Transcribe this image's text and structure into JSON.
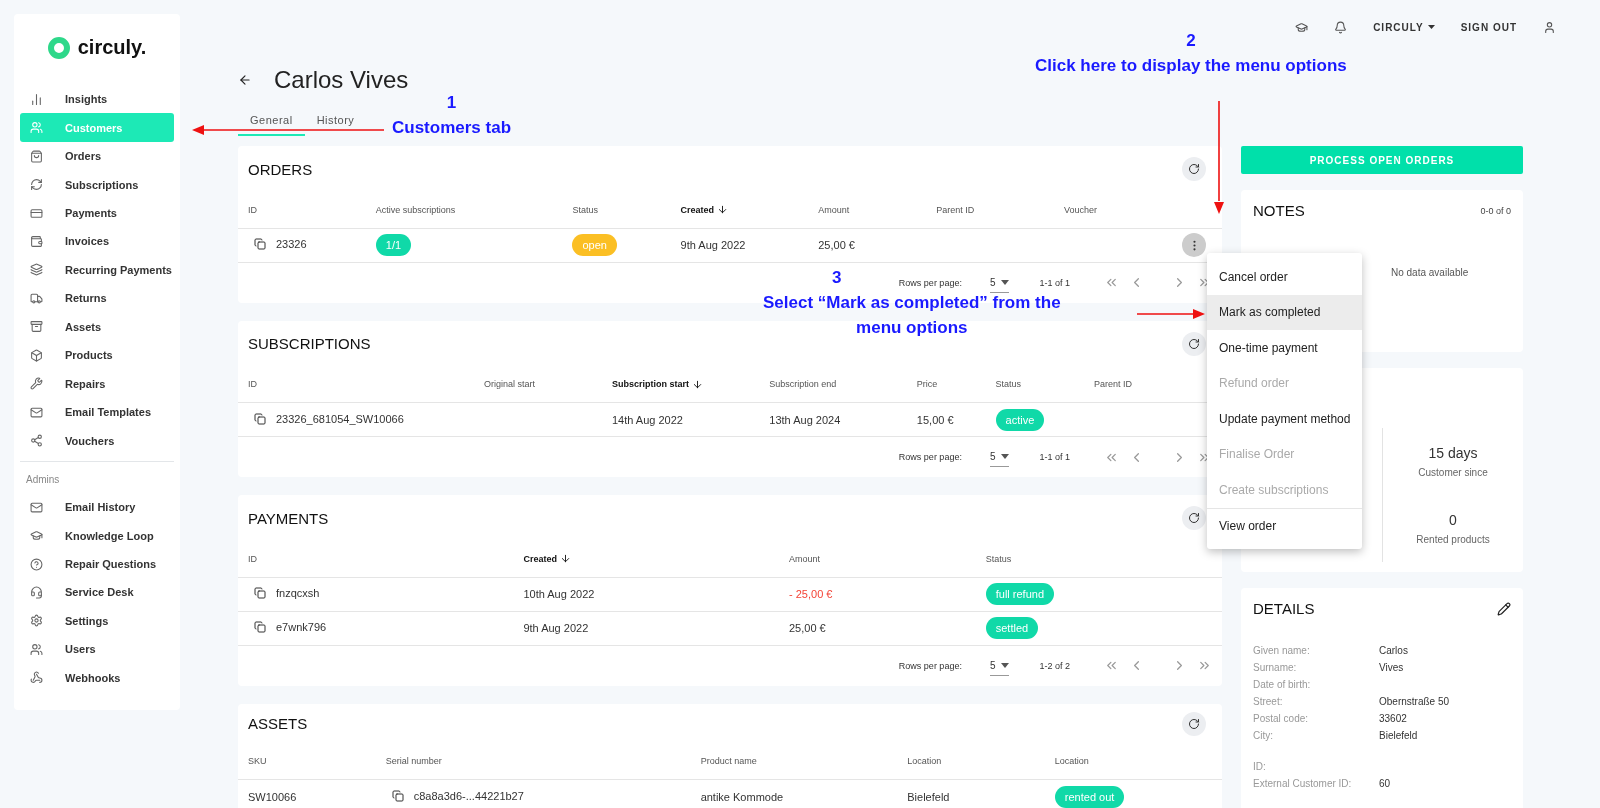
{
  "topbar": {
    "account": "CIRCULY",
    "sign_out": "SIGN OUT"
  },
  "sidebar": {
    "logo": "circuly.",
    "items": [
      {
        "label": "Insights",
        "selected": false
      },
      {
        "label": "Customers",
        "selected": true
      },
      {
        "label": "Orders",
        "selected": false
      },
      {
        "label": "Subscriptions",
        "selected": false
      },
      {
        "label": "Payments",
        "selected": false
      },
      {
        "label": "Invoices",
        "selected": false
      },
      {
        "label": "Recurring Payments",
        "selected": false
      },
      {
        "label": "Returns",
        "selected": false
      },
      {
        "label": "Assets",
        "selected": false
      },
      {
        "label": "Products",
        "selected": false
      },
      {
        "label": "Repairs",
        "selected": false
      },
      {
        "label": "Email Templates",
        "selected": false
      },
      {
        "label": "Vouchers",
        "selected": false
      }
    ],
    "section": "Admins",
    "admin_items": [
      {
        "label": "Email History",
        "selected": false
      },
      {
        "label": "Knowledge Loop",
        "selected": false
      },
      {
        "label": "Repair Questions",
        "selected": false
      },
      {
        "label": "Service Desk",
        "selected": false
      },
      {
        "label": "Settings",
        "selected": false
      },
      {
        "label": "Users",
        "selected": false
      },
      {
        "label": "Webhooks",
        "selected": false
      }
    ]
  },
  "page": {
    "title": "Carlos Vives",
    "tabs": [
      {
        "label": "General",
        "selected": true
      },
      {
        "label": "History",
        "selected": false
      }
    ]
  },
  "orders": {
    "title": "ORDERS",
    "columns": [
      {
        "label": "ID",
        "sorted": false
      },
      {
        "label": "Active subscriptions",
        "sorted": false
      },
      {
        "label": "Status",
        "sorted": false
      },
      {
        "label": "Created",
        "sorted": true
      },
      {
        "label": "Amount",
        "sorted": false
      },
      {
        "label": "Parent ID",
        "sorted": false
      },
      {
        "label": "Voucher",
        "sorted": false
      }
    ],
    "rows": [
      {
        "id": "23326",
        "active": "1/1",
        "status": "open",
        "color": "#fbbf24",
        "created": "9th Aug 2022",
        "amount": "25,00 €"
      }
    ],
    "pagination": {
      "label": "Rows per page:",
      "size": "5",
      "range": "1-1 of 1"
    }
  },
  "subscriptions": {
    "title": "SUBSCRIPTIONS",
    "columns": [
      {
        "label": "ID",
        "sorted": false
      },
      {
        "label": "Original start",
        "sorted": false
      },
      {
        "label": "Subscription start",
        "sorted": true
      },
      {
        "label": "Subscription end",
        "sorted": false
      },
      {
        "label": "Price",
        "sorted": false
      },
      {
        "label": "Status",
        "sorted": false
      },
      {
        "label": "Parent ID",
        "sorted": false
      }
    ],
    "rows": [
      {
        "id": "23326_681054_SW10066",
        "start": "14th Aug 2022",
        "end": "13th Aug 2024",
        "price": "15,00 €",
        "status": "active",
        "color": "#10d9a8"
      }
    ],
    "pagination": {
      "label": "Rows per page:",
      "size": "5",
      "range": "1-1 of 1"
    }
  },
  "payments": {
    "title": "PAYMENTS",
    "columns": [
      {
        "label": "ID",
        "sorted": false
      },
      {
        "label": "Created",
        "sorted": true
      },
      {
        "label": "Amount",
        "sorted": false
      },
      {
        "label": "Status",
        "sorted": false
      }
    ],
    "rows": [
      {
        "id": "fnzqcxsh",
        "created": "10th Aug 2022",
        "amount": "- 25,00 €",
        "negative": true,
        "status": "full refund",
        "color": "#10d9a8"
      },
      {
        "id": "e7wnk796",
        "created": "9th Aug 2022",
        "amount": "25,00 €",
        "negative": false,
        "status": "settled",
        "color": "#10d9a8"
      }
    ],
    "pagination": {
      "label": "Rows per page:",
      "size": "5",
      "range": "1-2 of 2"
    }
  },
  "assets": {
    "title": "ASSETS",
    "columns": [
      {
        "label": "SKU",
        "sorted": false
      },
      {
        "label": "Serial number",
        "sorted": false
      },
      {
        "label": "Product name",
        "sorted": false
      },
      {
        "label": "Location",
        "sorted": false
      },
      {
        "label": "Location",
        "sorted": false
      }
    ],
    "rows": [
      {
        "sku": "SW10066",
        "serial": "c8a8a3d6-...44221b27",
        "product": "antike Kommode",
        "location": "Bielefeld",
        "status": "rented out",
        "color": "#10d9a8"
      }
    ]
  },
  "process_button": "PROCESS OPEN ORDERS",
  "notes": {
    "title": "NOTES",
    "count": "0-0 of 0",
    "empty": "No data available"
  },
  "stats": [
    {
      "value": "15 days",
      "label": "Customer since"
    },
    {
      "value": "0",
      "label": "Rented products"
    }
  ],
  "details": {
    "title": "DETAILS",
    "groups": [
      [
        {
          "label": "Given name:",
          "value": "Carlos"
        },
        {
          "label": "Surname:",
          "value": "Vives"
        },
        {
          "label": "Date of birth:"
        },
        {
          "label": "Street:",
          "value": "Obernstraße 50"
        },
        {
          "label": "Postal code:",
          "value": "33602"
        },
        {
          "label": "City:",
          "value": "Bielefeld"
        }
      ],
      [
        {
          "label": "ID:"
        },
        {
          "label": "External Customer ID:",
          "value": "60"
        }
      ]
    ]
  },
  "menu": [
    {
      "label": "Cancel order",
      "disabled": false,
      "selected": false,
      "divided": false
    },
    {
      "label": "Mark as completed",
      "disabled": false,
      "selected": true,
      "divided": false
    },
    {
      "label": "One-time payment",
      "disabled": false,
      "selected": false,
      "divided": false
    },
    {
      "label": "Refund order",
      "disabled": true,
      "selected": false,
      "divided": false
    },
    {
      "label": "Update payment method",
      "disabled": false,
      "selected": false,
      "divided": false
    },
    {
      "label": "Finalise Order",
      "disabled": true,
      "selected": false,
      "divided": false
    },
    {
      "label": "Create subscriptions",
      "disabled": true,
      "selected": false,
      "divided": false
    },
    {
      "label": "View order",
      "disabled": false,
      "selected": false,
      "divided": true
    }
  ],
  "annotations": [
    {
      "number": "1",
      "lines": [
        "Customers tab"
      ],
      "kind": "left"
    },
    {
      "number": "2",
      "lines": [
        "Click here to display the menu options"
      ],
      "kind": "down"
    },
    {
      "number": "3",
      "lines": [
        "Select “Mark as completed” from the",
        "menu options"
      ],
      "kind": "right"
    }
  ]
}
